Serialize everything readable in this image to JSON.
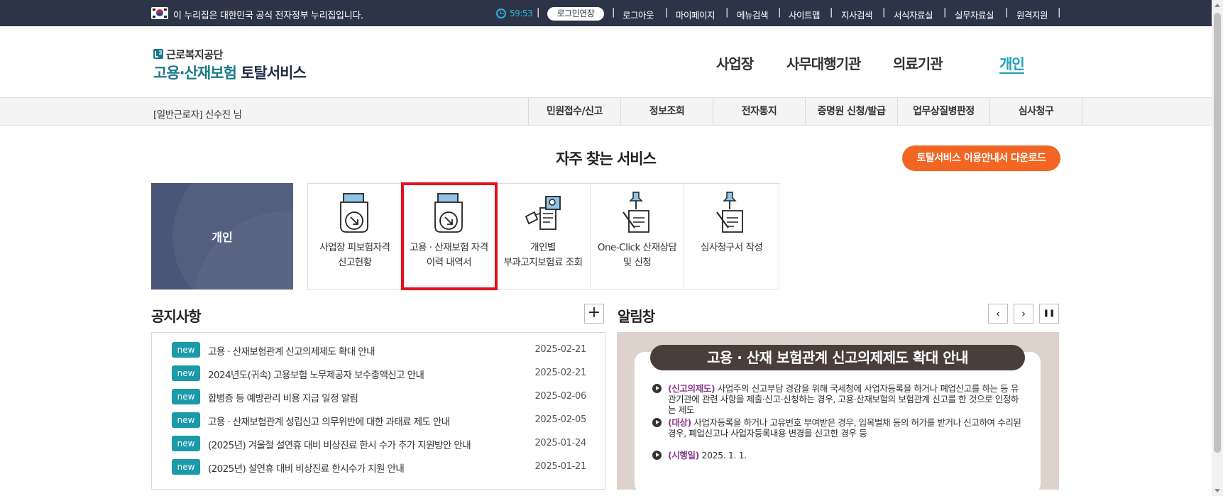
{
  "gov_bar": {
    "notice": "이 누리집은 대한민국 공식 전자정부 누리집입니다.",
    "timer": "59:53",
    "extend_login": "로그인연장",
    "links": [
      "로그아웃",
      "마이페이지",
      "메뉴검색",
      "사이트맵",
      "지사검색",
      "서식자료실",
      "실무자료실",
      "원격지원"
    ]
  },
  "header": {
    "org_name": "근로복지공단",
    "title_part1": "고용·산재보험",
    "title_part2": "토탈서비스",
    "nav": [
      "사업장",
      "사무대행기관",
      "의료기관",
      "개인"
    ],
    "active_nav": "개인"
  },
  "sub_bar": {
    "user_text": "[일반근로자] 신수진 님",
    "tabs": [
      "민원접수/신고",
      "정보조회",
      "전자통지",
      "증명원 신청/발급",
      "업무상질병판정",
      "심사청구"
    ]
  },
  "frequent": {
    "title": "자주 찾는 서비스",
    "guide_button": "토탈서비스 이용안내서 다운로드",
    "category": "개인",
    "services": [
      {
        "label": "사업장 피보험자격 신고현황",
        "icon": "document-download-icon"
      },
      {
        "label": "고용 · 산재보험 자격 이력 내역서",
        "icon": "document-download-icon",
        "highlighted": true
      },
      {
        "label": "개인별 부과고지보험료 조회",
        "icon": "search-document-icon"
      },
      {
        "label": "One-Click 산재상담 및 신청",
        "icon": "pen-document-icon"
      },
      {
        "label": "심사청구서 작성",
        "icon": "pen-document-icon"
      }
    ]
  },
  "notices": {
    "title": "공지사항",
    "more": "+",
    "badge": "new",
    "items": [
      {
        "title": "고용 · 산재보험관계 신고의제제도 확대 안내",
        "date": "2025-02-21"
      },
      {
        "title": "2024년도(귀속) 고용보험 노무제공자 보수총액신고 안내",
        "date": "2025-02-21"
      },
      {
        "title": "합병증 등 예방관리 비용 지급 일정 알림",
        "date": "2025-02-06"
      },
      {
        "title": "고용 · 산재보험관계 성립신고 의무위반에 대한 과태료 제도 안내",
        "date": "2025-02-05"
      },
      {
        "title": "(2025년) 겨울철 설연휴 대비 비상진료 한시 수가 추가 지원방안 안내",
        "date": "2025-01-24"
      },
      {
        "title": "(2025년) 설연휴 대비 비상진료 한시수가 지원 안내",
        "date": "2025-01-21"
      }
    ]
  },
  "alarm": {
    "title": "알림창",
    "controls": {
      "prev": "‹",
      "next": "›",
      "pause": "❚❚"
    },
    "banner": {
      "heading": "고용 · 산재 보험관계 신고의제제도 확대 안내",
      "items": [
        {
          "key": "(신고의제도)",
          "text": "사업주의 신고부담 경감을 위해 국세청에 사업자등록을 하거나 폐업신고를 하는 등 유관기관에 관련 사항을 제출·신고·신청하는 경우, 고용·산재보험의 보험관계 신고를 한 것으로 인정하는 제도"
        },
        {
          "key": "(대상)",
          "text": "사업자등록을 하거나 고유번호 부여받은 경우, 입목벌채 등의 허가를 받거나 신고하여 수리된 경우, 폐업신고나 사업자등록내용 변경을 신고한 경우 등"
        },
        {
          "key": "(시행일)",
          "text": "2025. 1. 1."
        }
      ]
    }
  },
  "colors": {
    "gov_bar_bg": "#2e3447",
    "accent_teal": "#1aa0b8",
    "guide_orange": "#f26522",
    "highlight_red": "#e5101d",
    "card_navy": "#4a5578",
    "badge_teal": "#1b9aaa"
  }
}
